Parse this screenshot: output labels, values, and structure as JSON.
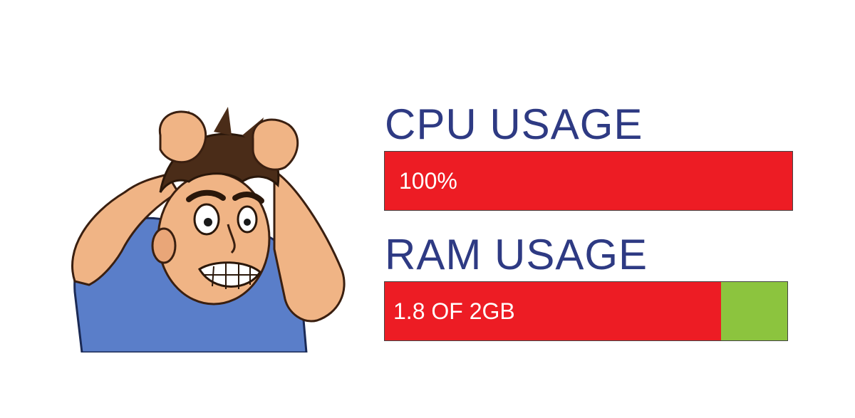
{
  "cpu": {
    "title": "CPU USAGE",
    "label": "100%",
    "fill_fraction": 1.0
  },
  "ram": {
    "title": "RAM USAGE",
    "label": "1.8 OF 2GB",
    "fill_fraction": 0.835
  },
  "colors": {
    "title": "#2e3a83",
    "used": "#ed1c24",
    "free": "#8cc43e",
    "label": "#ffffff"
  },
  "illustration_icon": "frustrated-man-pulling-hair-icon"
}
